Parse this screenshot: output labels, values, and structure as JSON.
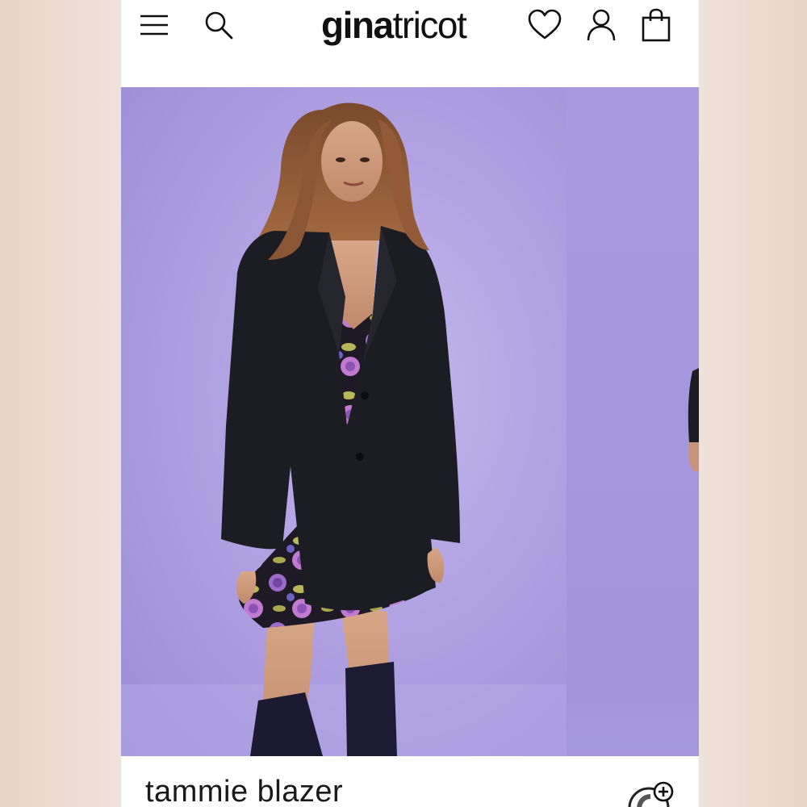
{
  "header": {
    "logo_bold": "gina",
    "logo_regular": "tricot",
    "menu_icon": "hamburger-menu-icon",
    "search_icon": "search-icon",
    "wishlist_icon": "heart-icon",
    "account_icon": "user-icon",
    "cart_icon": "shopping-bag-icon"
  },
  "product": {
    "name": "tammie blazer",
    "add_icon": "add-to-wishlist-icon"
  },
  "colors": {
    "backdrop": "#b0a2e2",
    "blazer": "#1c1d22",
    "page_bg": "#efe2da"
  }
}
